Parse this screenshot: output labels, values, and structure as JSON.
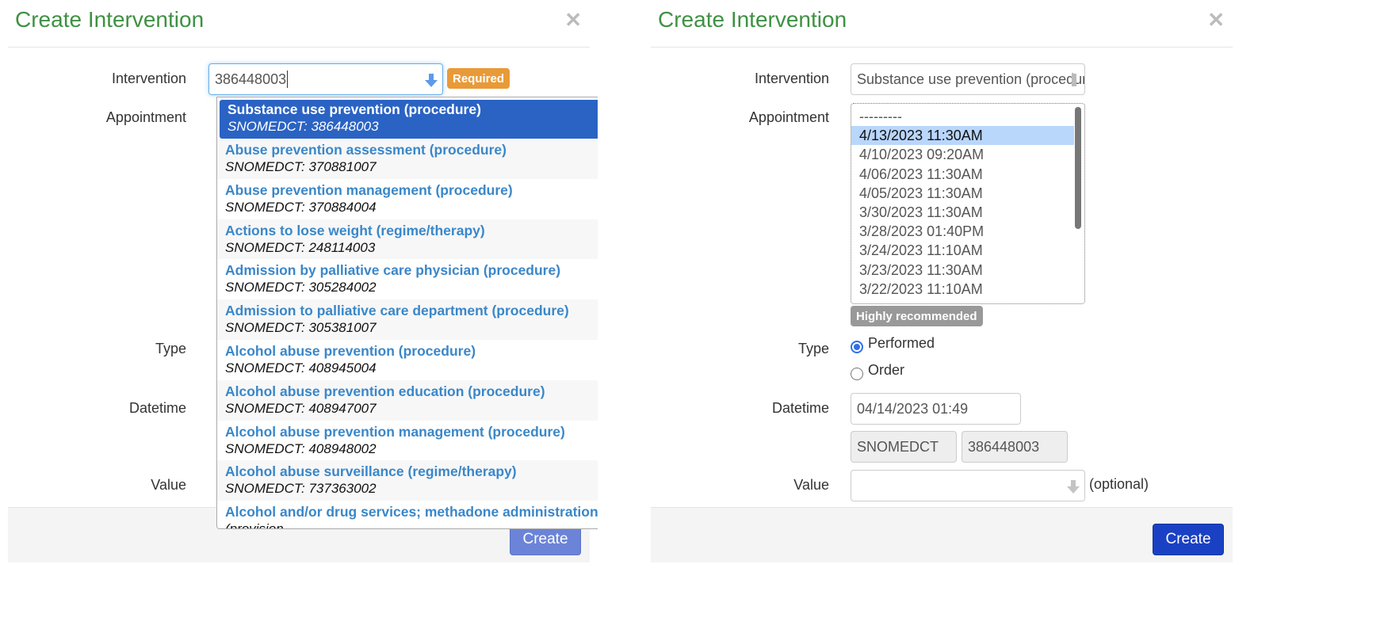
{
  "left_modal": {
    "title": "Create Intervention",
    "close_icon": "close-icon",
    "labels": {
      "intervention": "Intervention",
      "appointment": "Appointment",
      "type": "Type",
      "datetime": "Datetime",
      "value": "Value"
    },
    "intervention_input": {
      "value": "386448003",
      "icon": "down-arrow-icon"
    },
    "required_badge": "Required",
    "dropdown_items": [
      {
        "name": "Substance use prevention (procedure)",
        "code": "SNOMEDCT: 386448003",
        "selected": true
      },
      {
        "name": "Abuse prevention assessment (procedure)",
        "code": "SNOMEDCT: 370881007"
      },
      {
        "name": "Abuse prevention management (procedure)",
        "code": "SNOMEDCT: 370884004"
      },
      {
        "name": "Actions to lose weight (regime/therapy)",
        "code": "SNOMEDCT: 248114003"
      },
      {
        "name": "Admission by palliative care physician (procedure)",
        "code": "SNOMEDCT: 305284002"
      },
      {
        "name": "Admission to palliative care department (procedure)",
        "code": "SNOMEDCT: 305381007"
      },
      {
        "name": "Alcohol abuse prevention (procedure)",
        "code": "SNOMEDCT: 408945004"
      },
      {
        "name": "Alcohol abuse prevention education (procedure)",
        "code": "SNOMEDCT: 408947007"
      },
      {
        "name": "Alcohol abuse prevention management (procedure)",
        "code": "SNOMEDCT: 408948002"
      },
      {
        "name": "Alcohol abuse surveillance (regime/therapy)",
        "code": "SNOMEDCT: 737363002"
      },
      {
        "name": "Alcohol and/or drug services; methadone administration",
        "code": "(provision"
      }
    ],
    "create_button": "Create"
  },
  "right_modal": {
    "title": "Create Intervention",
    "close_icon": "close-icon",
    "labels": {
      "intervention": "Intervention",
      "appointment": "Appointment",
      "type": "Type",
      "datetime": "Datetime",
      "value": "Value"
    },
    "intervention_input": {
      "value": "Substance use prevention (procedure)"
    },
    "appointments": [
      {
        "label": "---------"
      },
      {
        "label": "4/13/2023 11:30AM",
        "selected": true
      },
      {
        "label": "4/10/2023 09:20AM"
      },
      {
        "label": "4/06/2023 11:30AM"
      },
      {
        "label": "4/05/2023 11:30AM"
      },
      {
        "label": "3/30/2023 11:30AM"
      },
      {
        "label": "3/28/2023 01:40PM"
      },
      {
        "label": "3/24/2023 11:10AM"
      },
      {
        "label": "3/23/2023 11:30AM"
      },
      {
        "label": "3/22/2023 11:10AM"
      }
    ],
    "recommended_badge": "Highly recommended",
    "type_options": [
      {
        "label": "Performed",
        "checked": true
      },
      {
        "label": "Order",
        "checked": false
      }
    ],
    "datetime_value": "04/14/2023 01:49",
    "code_system": "SNOMEDCT",
    "code_value": "386448003",
    "value_input": "",
    "optional_text": "(optional)",
    "create_button": "Create"
  }
}
